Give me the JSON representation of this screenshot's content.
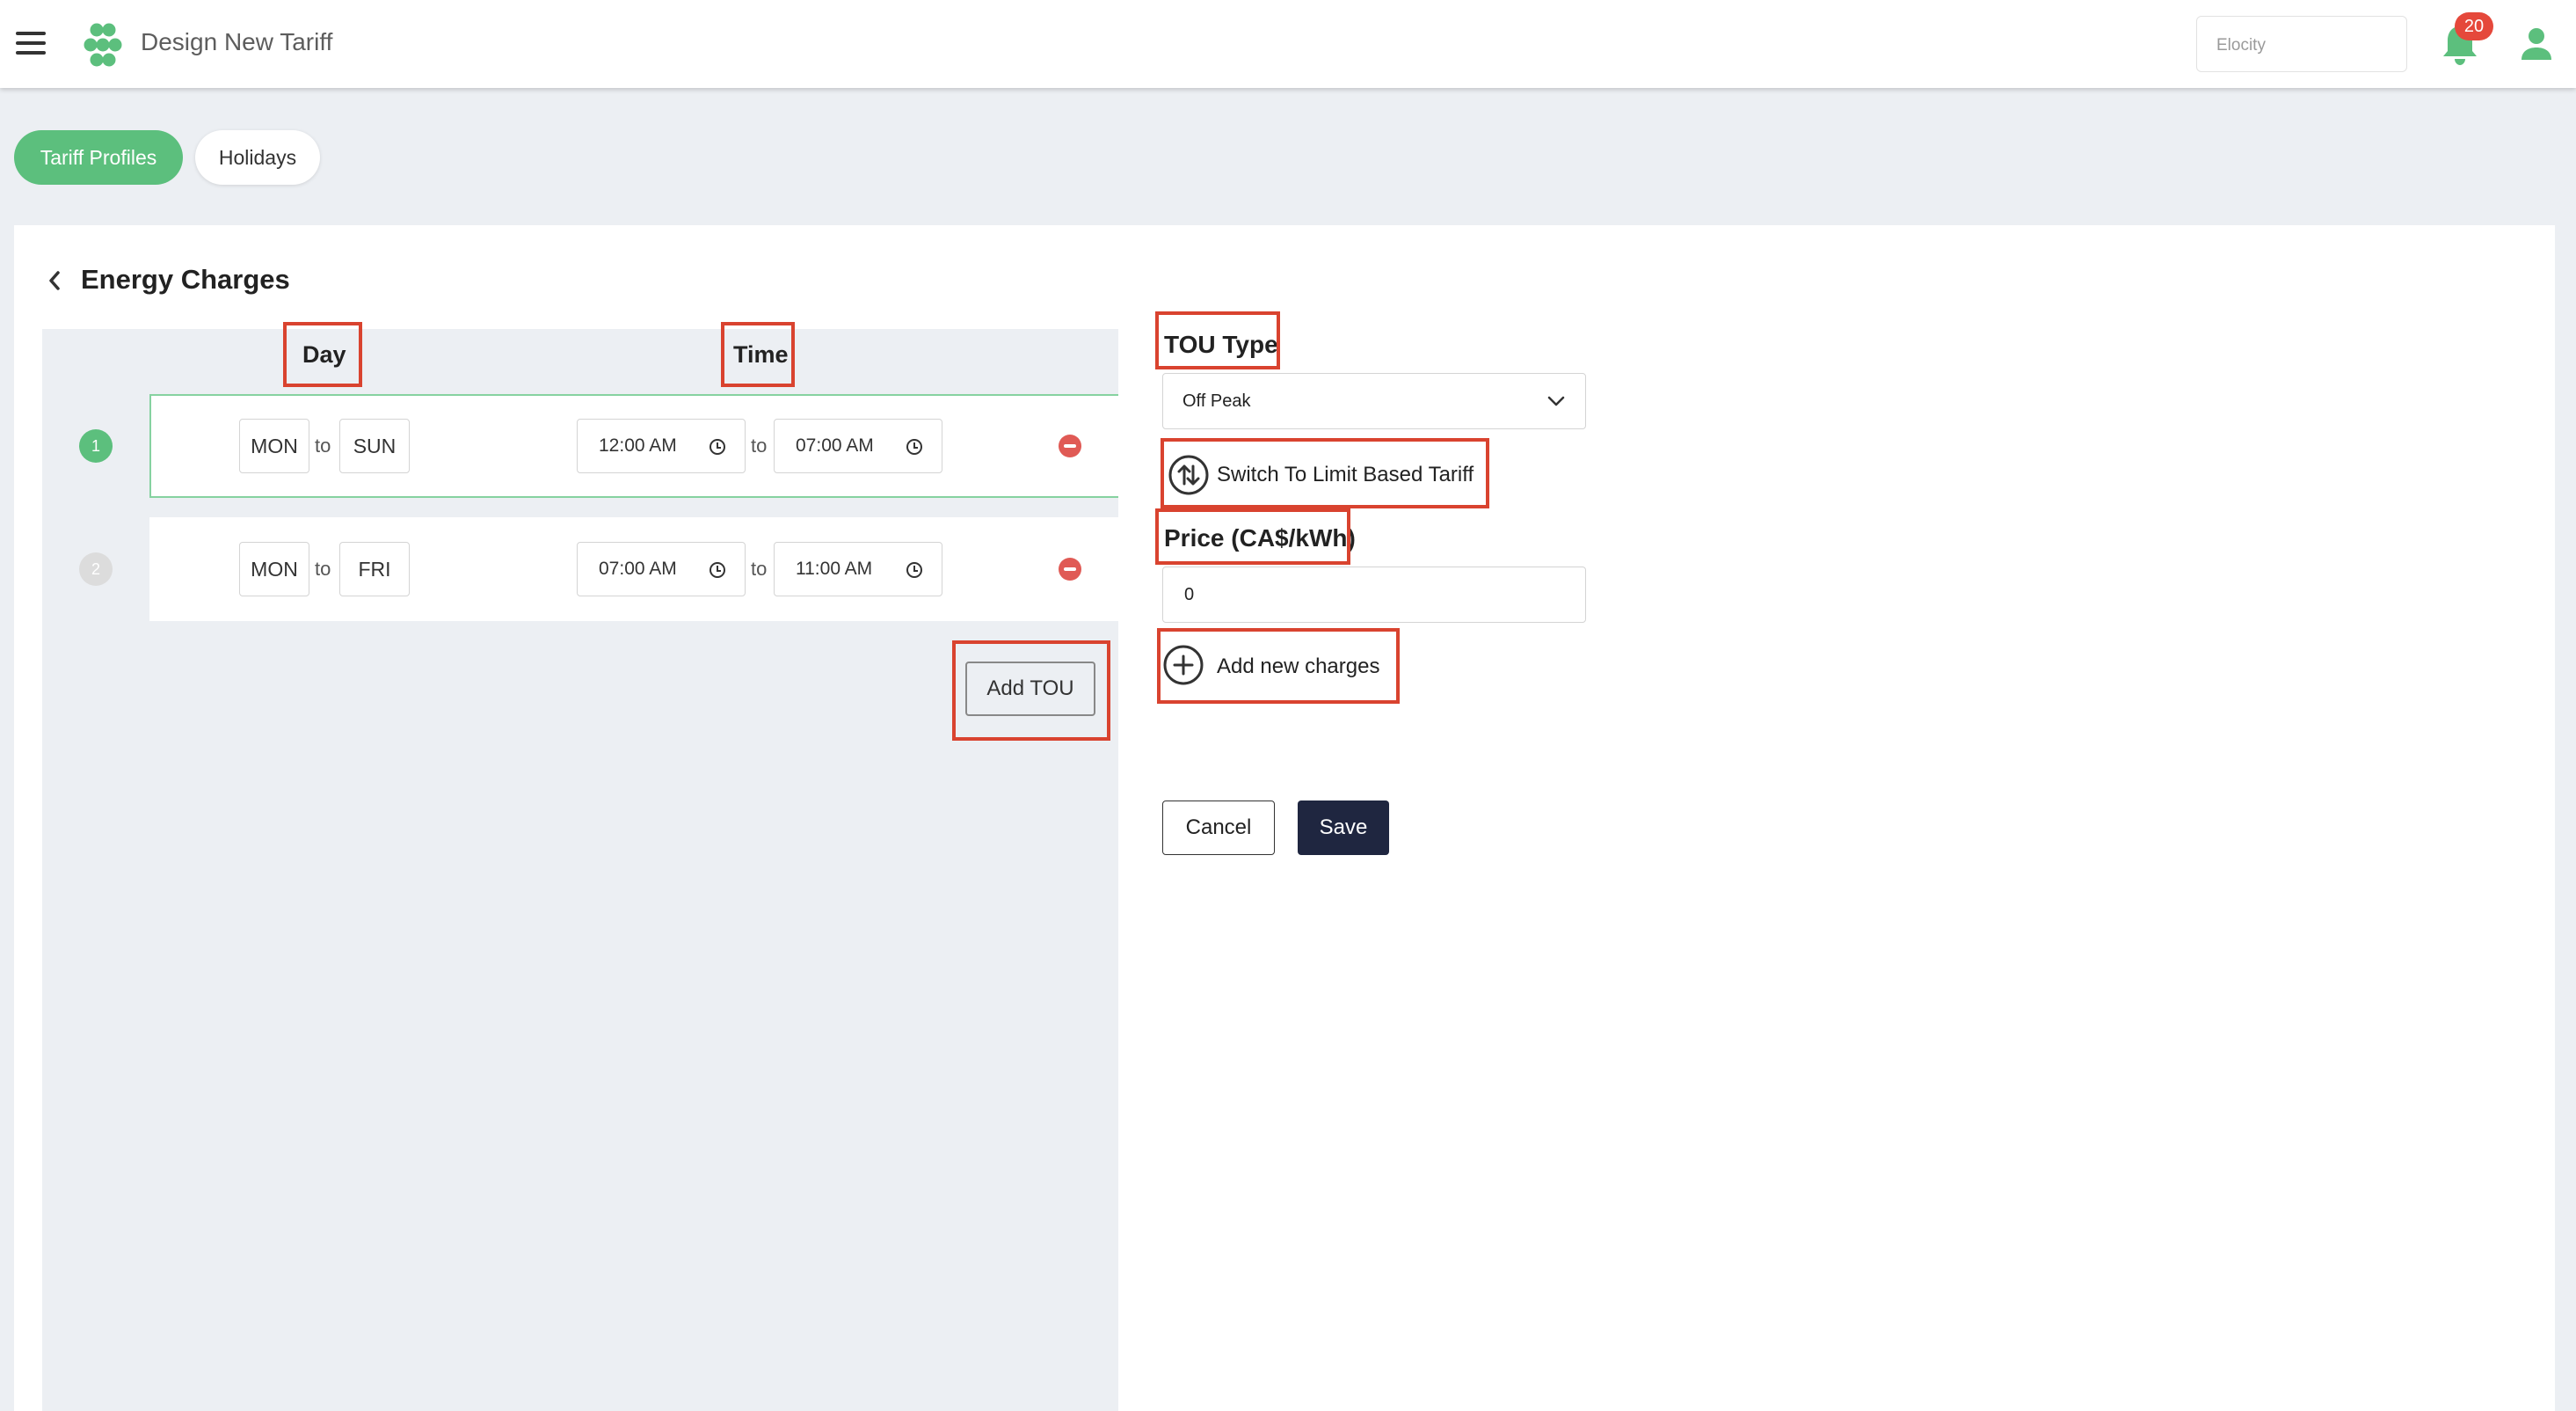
{
  "header": {
    "title": "Design New Tariff",
    "company": "Elocity",
    "notification_count": "20"
  },
  "tabs": [
    {
      "label": "Tariff Profiles",
      "active": true
    },
    {
      "label": "Holidays",
      "active": false
    }
  ],
  "section": {
    "title": "Energy Charges"
  },
  "schedule": {
    "day_header": "Day",
    "time_header": "Time",
    "to_label": "to",
    "rows": [
      {
        "number": "1",
        "day_from": "MON",
        "day_to": "SUN",
        "time_from": "12:00 AM",
        "time_to": "07:00 AM",
        "active": true
      },
      {
        "number": "2",
        "day_from": "MON",
        "day_to": "FRI",
        "time_from": "07:00 AM",
        "time_to": "11:00 AM",
        "active": false
      }
    ],
    "add_button": "Add TOU"
  },
  "form": {
    "tou_type_label": "TOU Type",
    "tou_type_value": "Off Peak",
    "switch_link": "Switch To Limit Based Tariff",
    "price_label": "Price (CA$/kWh)",
    "price_value": "0",
    "add_charges": "Add new charges",
    "cancel": "Cancel",
    "save": "Save"
  },
  "colors": {
    "accent_green": "#5cbf7d",
    "highlight_red": "#d9432f",
    "save_navy": "#1f2640",
    "badge_red": "#e5483b"
  },
  "icons": [
    "menu-icon",
    "app-logo",
    "bell-icon",
    "user-icon",
    "chevron-left-icon",
    "clock-icon",
    "remove-icon",
    "chevron-down-icon",
    "switch-arrows-icon",
    "plus-circle-icon"
  ]
}
